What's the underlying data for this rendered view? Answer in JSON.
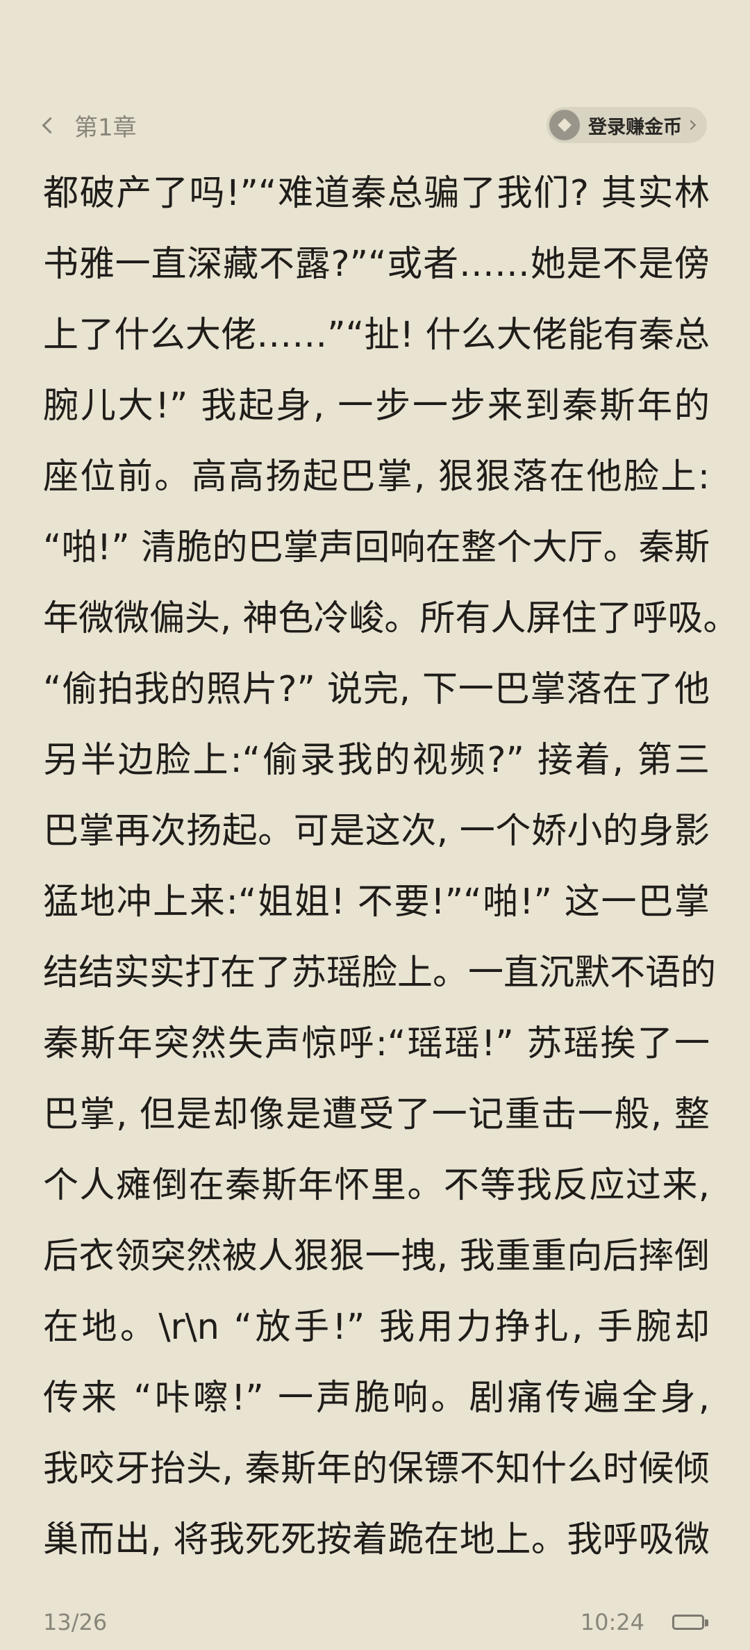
{
  "header": {
    "chapter_title": "第1章",
    "coin_button_label": "登录赚金币"
  },
  "content": {
    "lines": [
      "都破产了吗!”“难道秦总骗了我们? 其实林",
      "书雅一直深藏不露?”“或者……她是不是傍",
      "上了什么大佬……”“扯! 什么大佬能有秦总",
      "腕儿大!” 我起身, 一步一步来到秦斯年的",
      "座位前。高高扬起巴掌, 狠狠落在他脸上:",
      "“啪!” 清脆的巴掌声回响在整个大厅。秦斯",
      "年微微偏头, 神色冷峻。所有人屏住了呼吸。",
      "“偷拍我的照片?” 说完, 下一巴掌落在了他",
      "另半边脸上:“偷录我的视频?” 接着, 第三",
      "巴掌再次扬起。可是这次, 一个娇小的身影",
      "猛地冲上来:“姐姐! 不要!”“啪!” 这一巴掌",
      "结结实实打在了苏瑶脸上。一直沉默不语的",
      "秦斯年突然失声惊呼:“瑶瑶!” 苏瑶挨了一",
      "巴掌, 但是却像是遭受了一记重击一般, 整",
      "个人瘫倒在秦斯年怀里。不等我反应过来,",
      "后衣领突然被人狠狠一拽, 我重重向后摔倒",
      "在地。\\r\\n “放手!” 我用力挣扎, 手腕却",
      "传来 “咔嚓!” 一声脆响。剧痛传遍全身,",
      "我咬牙抬头, 秦斯年的保镖不知什么时候倾",
      "巢而出, 将我死死按着跪在地上。我呼吸微"
    ]
  },
  "footer": {
    "page_indicator": "13/26",
    "clock": "10:24",
    "battery_level": 0.95
  },
  "icons": {
    "back": "chevron-left-icon",
    "coin": "coin-icon",
    "coin_chevron": "chevron-right-icon",
    "battery": "battery-icon"
  },
  "colors": {
    "background": "#e9e3d1",
    "text": "#1f1d1a",
    "muted": "#8a857b",
    "pill": "#d9d3c1"
  }
}
